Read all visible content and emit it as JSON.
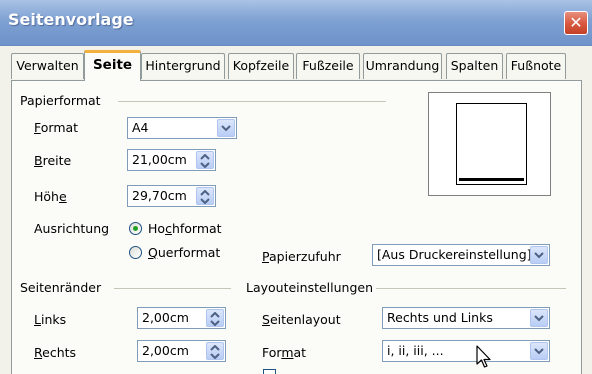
{
  "window": {
    "title": "Seitenvorlage",
    "close_symbol": "✕"
  },
  "tabs": [
    {
      "label": "Verwalten",
      "active": false
    },
    {
      "label": "Seite",
      "active": true
    },
    {
      "label": "Hintergrund",
      "active": false
    },
    {
      "label": "Kopfzeile",
      "active": false
    },
    {
      "label": "Fußzeile",
      "active": false
    },
    {
      "label": "Umrandung",
      "active": false
    },
    {
      "label": "Spalten",
      "active": false
    },
    {
      "label": "Fußnote",
      "active": false
    }
  ],
  "papierformat": {
    "group_label": "Papierformat",
    "format": {
      "label_first": "F",
      "label_rest": "ormat",
      "value": "A4"
    },
    "breite": {
      "label_first": "B",
      "label_rest": "reite",
      "value": "21,00cm"
    },
    "hoehe": {
      "label_pre": "Höh",
      "label_ul": "e",
      "value": "29,70cm"
    },
    "ausrichtung": {
      "label": "Ausrichtung",
      "hochformat": {
        "label_pre": "Ho",
        "label_ul": "c",
        "label_post": "hformat",
        "selected": true
      },
      "querformat": {
        "label_first": "Q",
        "label_rest": "uerformat",
        "selected": false
      }
    },
    "papierzufuhr": {
      "label_first": "P",
      "label_rest": "apierzufuhr",
      "value": "[Aus Druckereinstellung]"
    }
  },
  "seitenraender": {
    "group_label": "Seitenränder",
    "links": {
      "label_first": "L",
      "label_rest": "inks",
      "value": "2,00cm"
    },
    "rechts": {
      "label_first": "R",
      "label_rest": "echts",
      "value": "2,00cm"
    }
  },
  "layouteinstellungen": {
    "group_label": "Layouteinstellungen",
    "seitenlayout": {
      "label_first": "S",
      "label_rest": "eitenlayout",
      "value": "Rechts und Links"
    },
    "format": {
      "label_pre": "For",
      "label_ul": "m",
      "label_post": "at",
      "value": "i, ii, iii, ..."
    }
  },
  "colors": {
    "titlebar": "#7fa1d2",
    "close_button": "#d7573f",
    "active_tab_accent": "#f4b13d",
    "radio_selected": "#21a121"
  },
  "icons": [
    "close-icon",
    "dropdown-arrow-icon",
    "spin-arrows-icon",
    "mouse-pointer-icon"
  ]
}
